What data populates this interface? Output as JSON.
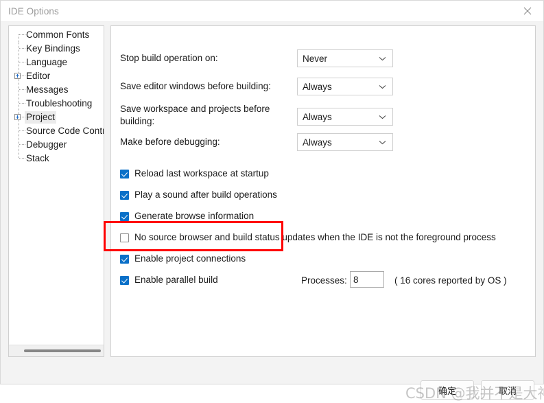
{
  "window": {
    "title": "IDE Options",
    "close_icon": "close-icon"
  },
  "sidebar": {
    "items": [
      {
        "label": "Common Fonts",
        "expandable": false,
        "selected": false
      },
      {
        "label": "Key Bindings",
        "expandable": false,
        "selected": false
      },
      {
        "label": "Language",
        "expandable": false,
        "selected": false
      },
      {
        "label": "Editor",
        "expandable": true,
        "selected": false
      },
      {
        "label": "Messages",
        "expandable": false,
        "selected": false
      },
      {
        "label": "Troubleshooting",
        "expandable": false,
        "selected": false
      },
      {
        "label": "Project",
        "expandable": true,
        "selected": true
      },
      {
        "label": "Source Code Contro",
        "expandable": false,
        "selected": false
      },
      {
        "label": "Debugger",
        "expandable": false,
        "selected": false
      },
      {
        "label": "Stack",
        "expandable": false,
        "selected": false
      }
    ]
  },
  "main": {
    "dropdowns": [
      {
        "label": "Stop build operation on:",
        "value": "Never"
      },
      {
        "label": "Save editor windows before building:",
        "value": "Always"
      },
      {
        "label": "Save workspace and projects before building:",
        "value": "Always"
      },
      {
        "label": "Make before debugging:",
        "value": "Always"
      }
    ],
    "checkboxes": [
      {
        "label": "Reload last workspace at startup",
        "checked": true
      },
      {
        "label": "Play a sound after build operations",
        "checked": true
      },
      {
        "label": "Generate browse information",
        "checked": true
      },
      {
        "label": "No source browser and build status updates when the IDE is not the foreground process",
        "checked": false
      },
      {
        "label": "Enable project connections",
        "checked": true
      },
      {
        "label": "Enable parallel build",
        "checked": true
      }
    ],
    "processes": {
      "label": "Processes:",
      "value": "8",
      "note": "( 16 cores reported by OS )"
    }
  },
  "footer": {
    "ok_label": "确定",
    "cancel_label": "取消"
  },
  "annotation": {
    "color": "#ff0000",
    "target": "Generate browse information"
  },
  "watermark": {
    "text": "CSDN @我并不是大神"
  }
}
